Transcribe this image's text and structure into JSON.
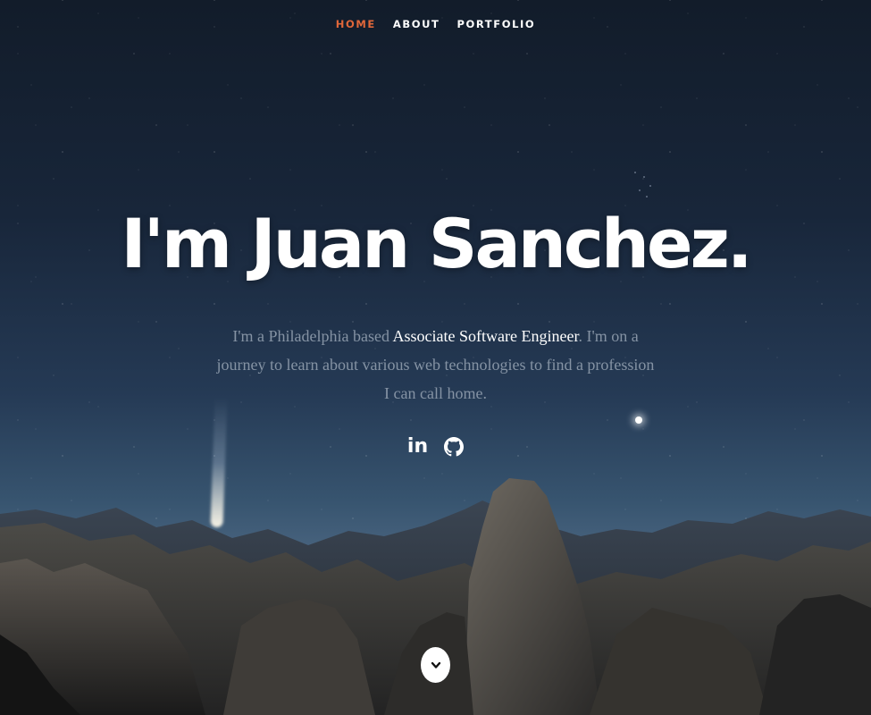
{
  "nav": {
    "items": [
      {
        "label": "HOME",
        "active": true
      },
      {
        "label": "ABOUT",
        "active": false
      },
      {
        "label": "PORTFOLIO",
        "active": false
      }
    ],
    "active_color": "#e0673a"
  },
  "hero": {
    "headline": "I'm Juan Sanchez.",
    "intro_prefix": "I'm a Philadelphia based ",
    "intro_highlight": "Associate Software Engineer",
    "intro_suffix": ". I'm on a journey to learn about various web technologies to find a profession I can call home."
  },
  "social": {
    "linkedin_icon": "linkedin-icon",
    "github_icon": "github-icon",
    "linkedin_glyph": "in"
  },
  "scroll": {
    "icon": "chevron-down-icon"
  }
}
